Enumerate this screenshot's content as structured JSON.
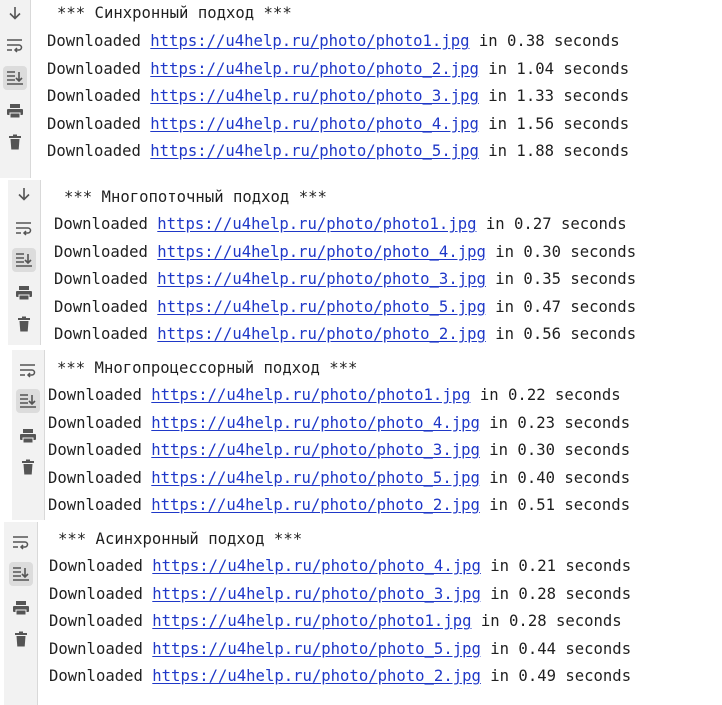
{
  "panels": [
    {
      "header": "*** Синхронный подход ***",
      "lines": [
        {
          "prefix": "Downloaded ",
          "url": "https://u4help.ru/photo/photo1.jpg",
          "suffix": " in 0.38 seconds"
        },
        {
          "prefix": "Downloaded ",
          "url": "https://u4help.ru/photo/photo_2.jpg",
          "suffix": " in 1.04 seconds"
        },
        {
          "prefix": "Downloaded ",
          "url": "https://u4help.ru/photo/photo_3.jpg",
          "suffix": " in 1.33 seconds"
        },
        {
          "prefix": "Downloaded ",
          "url": "https://u4help.ru/photo/photo_4.jpg",
          "suffix": " in 1.56 seconds"
        },
        {
          "prefix": "Downloaded ",
          "url": "https://u4help.ru/photo/photo_5.jpg",
          "suffix": " in 1.88 seconds"
        }
      ],
      "tools": [
        "arrow-down-icon",
        "soft-wrap-icon",
        "scroll-to-end-icon",
        "print-icon",
        "trash-icon"
      ]
    },
    {
      "header": "*** Многопоточный подход ***",
      "lines": [
        {
          "prefix": "Downloaded ",
          "url": "https://u4help.ru/photo/photo1.jpg",
          "suffix": " in 0.27 seconds"
        },
        {
          "prefix": "Downloaded ",
          "url": "https://u4help.ru/photo/photo_4.jpg",
          "suffix": " in 0.30 seconds"
        },
        {
          "prefix": "Downloaded ",
          "url": "https://u4help.ru/photo/photo_3.jpg",
          "suffix": " in 0.35 seconds"
        },
        {
          "prefix": "Downloaded ",
          "url": "https://u4help.ru/photo/photo_5.jpg",
          "suffix": " in 0.47 seconds"
        },
        {
          "prefix": "Downloaded ",
          "url": "https://u4help.ru/photo/photo_2.jpg",
          "suffix": " in 0.56 seconds"
        }
      ],
      "tools": [
        "arrow-down-icon",
        "soft-wrap-icon",
        "scroll-to-end-icon",
        "print-icon",
        "trash-icon"
      ]
    },
    {
      "header": "*** Многопроцессорный подход ***",
      "lines": [
        {
          "prefix": "Downloaded ",
          "url": "https://u4help.ru/photo/photo1.jpg",
          "suffix": " in 0.22 seconds"
        },
        {
          "prefix": "Downloaded ",
          "url": "https://u4help.ru/photo/photo_4.jpg",
          "suffix": " in 0.23 seconds"
        },
        {
          "prefix": "Downloaded ",
          "url": "https://u4help.ru/photo/photo_3.jpg",
          "suffix": " in 0.30 seconds"
        },
        {
          "prefix": "Downloaded ",
          "url": "https://u4help.ru/photo/photo_5.jpg",
          "suffix": " in 0.40 seconds"
        },
        {
          "prefix": "Downloaded ",
          "url": "https://u4help.ru/photo/photo_2.jpg",
          "suffix": " in 0.51 seconds"
        }
      ],
      "tools": [
        "soft-wrap-icon",
        "scroll-to-end-icon",
        "print-icon",
        "trash-icon"
      ]
    },
    {
      "header": "*** Асинхронный подход ***",
      "lines": [
        {
          "prefix": "Downloaded ",
          "url": "https://u4help.ru/photo/photo_4.jpg",
          "suffix": " in 0.21 seconds"
        },
        {
          "prefix": "Downloaded ",
          "url": "https://u4help.ru/photo/photo_3.jpg",
          "suffix": " in 0.28 seconds"
        },
        {
          "prefix": "Downloaded ",
          "url": "https://u4help.ru/photo/photo1.jpg",
          "suffix": " in 0.28 seconds"
        },
        {
          "prefix": "Downloaded ",
          "url": "https://u4help.ru/photo/photo_5.jpg",
          "suffix": " in 0.44 seconds"
        },
        {
          "prefix": "Downloaded ",
          "url": "https://u4help.ru/photo/photo_2.jpg",
          "suffix": " in 0.49 seconds"
        }
      ],
      "tools": [
        "soft-wrap-icon",
        "scroll-to-end-icon",
        "print-icon",
        "trash-icon"
      ]
    }
  ],
  "colors": {
    "link": "#1f38c8",
    "text": "#1f1f1f",
    "gutter": "#f2f2f2",
    "active_tool": "#dcdcdc"
  }
}
